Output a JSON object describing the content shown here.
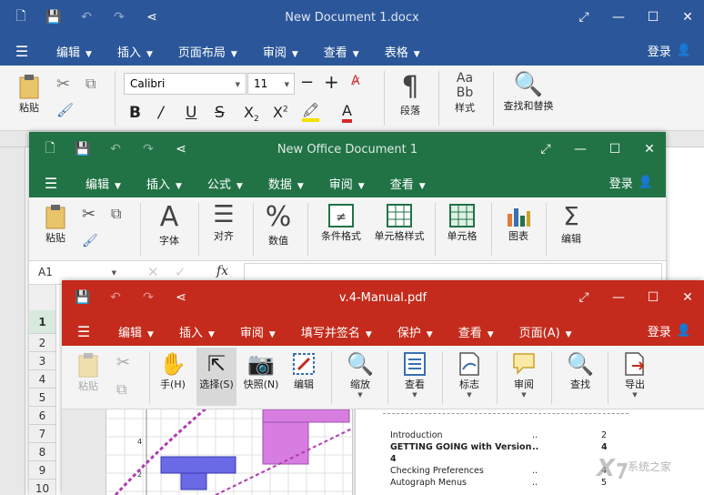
{
  "word": {
    "title": "New Document 1.docx",
    "menu": [
      "编辑",
      "插入",
      "页面布局",
      "审阅",
      "查看",
      "表格"
    ],
    "login": "登录",
    "font": "Calibri",
    "size": "11",
    "paste": "粘贴",
    "paragraph": "段落",
    "style_icon": "Aa\nBb",
    "style": "样式",
    "find_replace": "查找和替换",
    "accent": "#2b579a"
  },
  "excel": {
    "title": "New Office Document 1",
    "menu": [
      "编辑",
      "插入",
      "公式",
      "数据",
      "审阅",
      "查看"
    ],
    "login": "登录",
    "buttons": [
      "粘贴",
      "字体",
      "对齐",
      "数值",
      "条件格式",
      "单元格样式",
      "单元格",
      "图表",
      "编辑"
    ],
    "cell_ref": "A1",
    "fx": "fx",
    "row_numbers": [
      "1",
      "2",
      "3",
      "4",
      "5",
      "6",
      "7",
      "8",
      "9",
      "10"
    ],
    "accent": "#217346"
  },
  "pdf": {
    "title": "v.4-Manual.pdf",
    "menu": [
      "编辑",
      "插入",
      "审阅",
      "填写并签名",
      "保护",
      "查看",
      "页面(A)"
    ],
    "login": "登录",
    "buttons": [
      "粘贴",
      "手(H)",
      "选择(S)",
      "快照(N)",
      "编辑",
      "缩放",
      "查看",
      "标志",
      "审阅",
      "查找",
      "导出"
    ],
    "toc": [
      {
        "title": "Introduction",
        "dots": "..",
        "page": "2"
      },
      {
        "title": "GETTING GOING with Version 4",
        "dots": "..",
        "page": "4"
      },
      {
        "title": "Checking Preferences",
        "dots": "..",
        "page": "4"
      },
      {
        "title": "Autograph Menus",
        "dots": "..",
        "page": "5"
      }
    ],
    "axis_labels": [
      "4",
      "2"
    ],
    "accent": "#c42b1c"
  },
  "watermark": "系统之家"
}
